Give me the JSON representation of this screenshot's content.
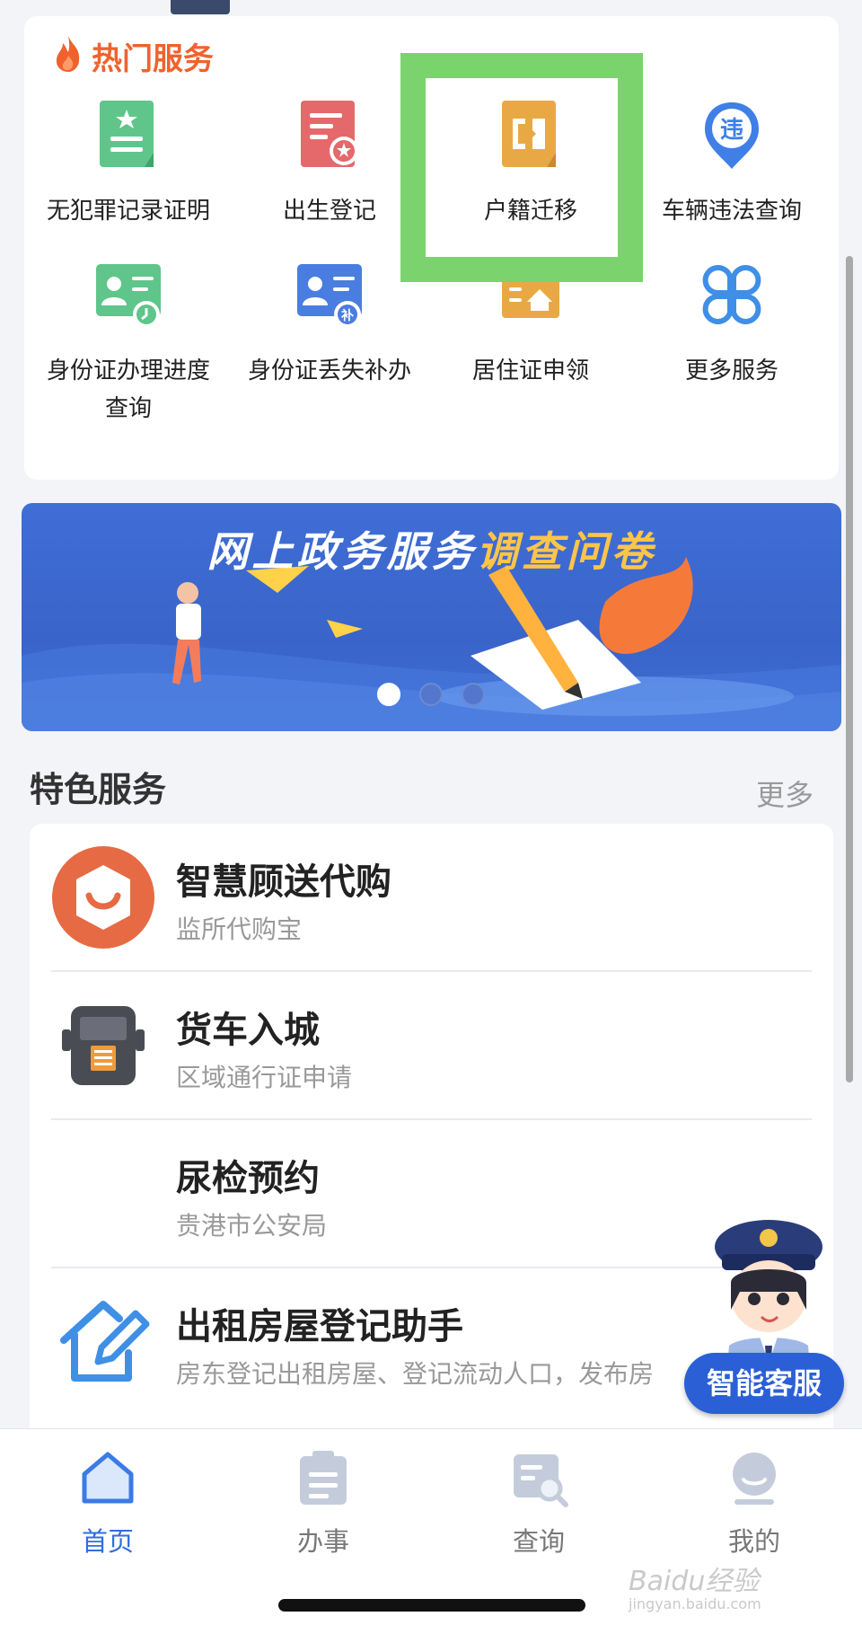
{
  "hot_services": {
    "title": "热门服务",
    "items": [
      {
        "label": "无犯罪记录证明",
        "icon": "certificate-star-icon",
        "color": "#5fc58a"
      },
      {
        "label": "出生登记",
        "icon": "birth-registration-icon",
        "color": "#e5686b"
      },
      {
        "label": "户籍迁移",
        "icon": "household-transfer-icon",
        "color": "#e8a945"
      },
      {
        "label": "车辆违法查询",
        "icon": "vehicle-violation-icon",
        "color": "#3f7fe6"
      },
      {
        "label": "身份证办理进度\n查询",
        "icon": "id-progress-icon",
        "color": "#5fc58a"
      },
      {
        "label": "身份证丢失补办",
        "icon": "id-replace-icon",
        "color": "#4a7de0"
      },
      {
        "label": "居住证申领",
        "icon": "residence-permit-icon",
        "color": "#e8a945"
      },
      {
        "label": "更多服务",
        "icon": "more-services-icon",
        "color": "#3f8fe6"
      }
    ],
    "violation_glyph": "违",
    "replace_glyph": "补"
  },
  "banner": {
    "title_main": "网上政务服务",
    "title_highlight": "调查问卷",
    "dots": 3,
    "active_dot": 0
  },
  "featured": {
    "title": "特色服务",
    "more": "更多",
    "items": [
      {
        "title": "智慧顾送代购",
        "subtitle": "监所代购宝",
        "icon": "smile-bag-icon"
      },
      {
        "title": "货车入城",
        "subtitle": "区域通行证申请",
        "icon": "truck-icon"
      },
      {
        "title": "尿检预约",
        "subtitle": "贵港市公安局",
        "icon": ""
      },
      {
        "title": "出租房屋登记助手",
        "subtitle": "房东登记出租房屋、登记流动人口，发布房",
        "icon": "house-edit-icon"
      }
    ]
  },
  "chatbot": {
    "label": "智能客服"
  },
  "tabbar": {
    "items": [
      {
        "label": "首页",
        "icon": "home-icon",
        "active": true
      },
      {
        "label": "办事",
        "icon": "clipboard-icon",
        "active": false
      },
      {
        "label": "查询",
        "icon": "search-doc-icon",
        "active": false
      },
      {
        "label": "我的",
        "icon": "user-icon",
        "active": false
      }
    ]
  },
  "watermark": {
    "line1": "Baidu经验",
    "line2": "jingyan.baidu.com"
  },
  "colors": {
    "accent": "#2f6ee0",
    "hot": "#f0622d",
    "highlight_box": "#7bd36d"
  }
}
